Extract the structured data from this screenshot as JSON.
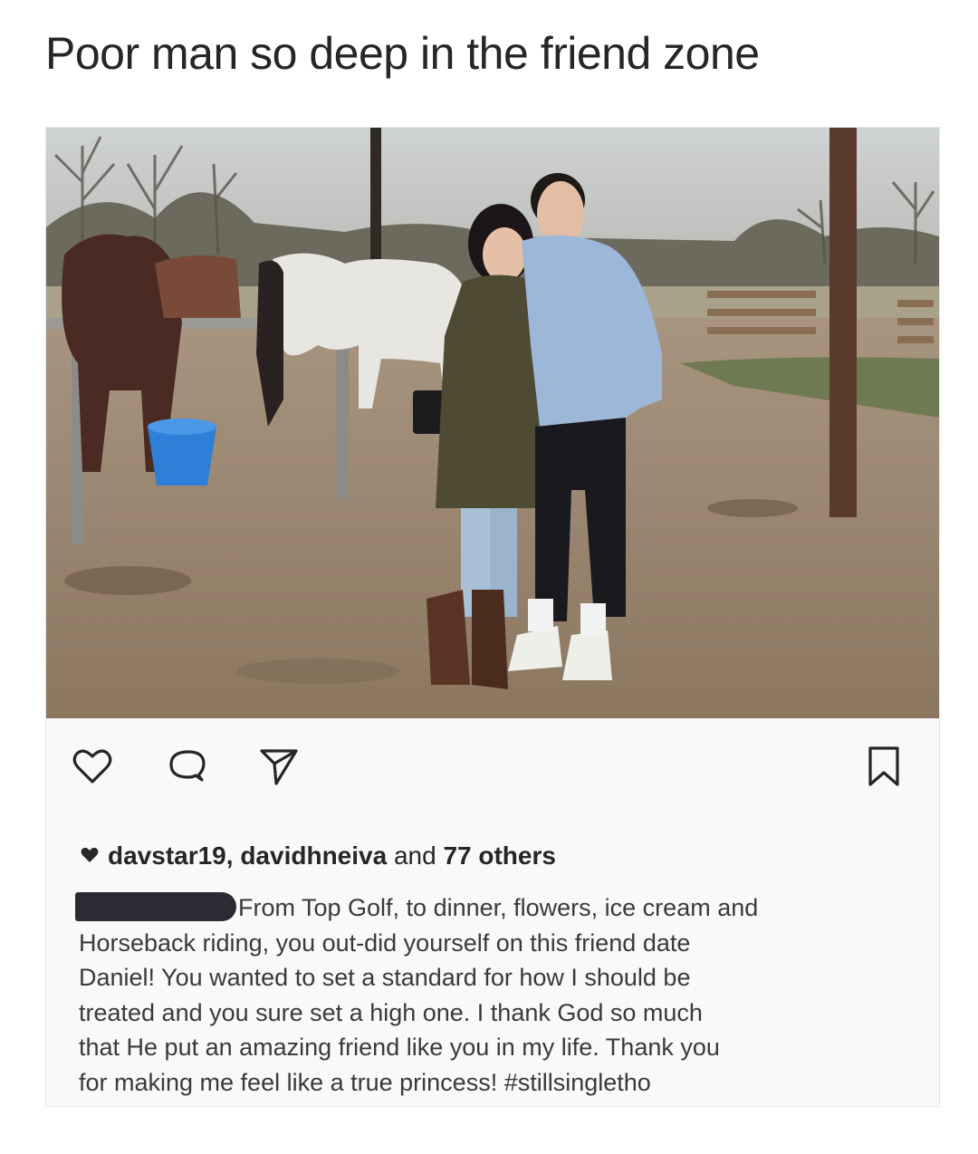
{
  "meme": {
    "title": "Poor man so deep in the friend zone"
  },
  "post": {
    "photo": {
      "description_icon": "photo-two-people-with-horses"
    },
    "actions": {
      "like_icon": "heart-outline-icon",
      "comment_icon": "comment-bubble-icon",
      "share_icon": "send-paper-plane-icon",
      "save_icon": "bookmark-icon"
    },
    "likes": {
      "user1": "davstar19,",
      "user2": "davidhneiva",
      "connector": "and",
      "others": "77 others"
    },
    "caption": {
      "redacted_username": true,
      "lines": [
        "From Top Golf, to dinner, flowers, ice cream and",
        "Horseback riding, you out-did yourself on this friend date",
        "Daniel! You wanted to set a standard for how I should be",
        "treated and you sure set a high one. I thank God so much",
        "that He put an amazing friend like you in my life. Thank you",
        "for making me feel like a true princess! #stillsingletho"
      ]
    }
  },
  "colors": {
    "background": "#ffffff",
    "card": "#f9f9f9",
    "text": "#262626",
    "redaction": "#2b2b33"
  }
}
